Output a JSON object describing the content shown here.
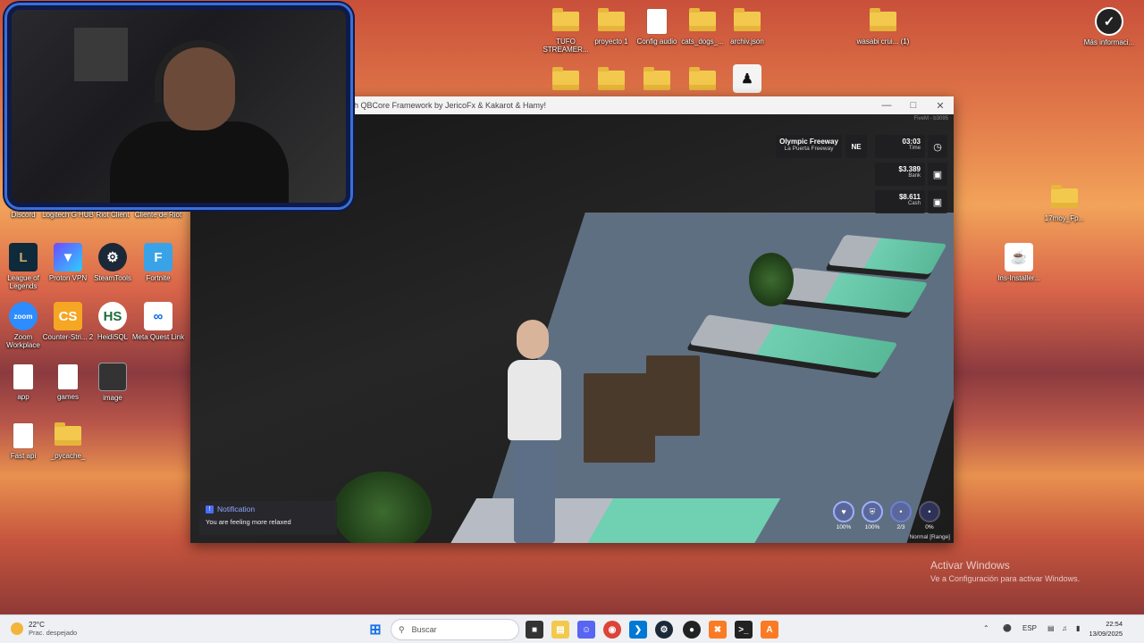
{
  "desktop": {
    "top_icons": [
      {
        "label": "TUFO STREAMER...",
        "type": "folder"
      },
      {
        "label": "proyecto 1",
        "type": "folder"
      },
      {
        "label": "Config audio",
        "type": "doc"
      },
      {
        "label": "cats_dogs_...",
        "type": "folder"
      },
      {
        "label": "archiv.json",
        "type": "folder"
      },
      {
        "label": "wasabi crui... (1)",
        "type": "folder"
      }
    ],
    "right_icons": [
      {
        "label": "Más informaci...",
        "type": "help"
      },
      {
        "label": "17moy_Fp...",
        "type": "folder"
      },
      {
        "label": "Ins-Installer...",
        "type": "java"
      }
    ],
    "left_icons": [
      {
        "label": "Discord"
      },
      {
        "label": "Logitech G HUB"
      },
      {
        "label": "Riot Client"
      },
      {
        "label": "Cliente de Riot"
      },
      {
        "label": "League of Legends"
      },
      {
        "label": "Proton VPN"
      },
      {
        "label": "SteamTools"
      },
      {
        "label": "Fortnite"
      },
      {
        "label": "Zoom Workplace"
      },
      {
        "label": "Counter-Stri... 2"
      },
      {
        "label": "HeidiSQL"
      },
      {
        "label": "Meta Quest Link"
      },
      {
        "label": "app"
      },
      {
        "label": "games"
      },
      {
        "label": "image"
      },
      {
        "label": "Fast api"
      },
      {
        "label": "_pycache_"
      }
    ]
  },
  "game_window": {
    "title": "with QBCore Framework by JericoFx & Kakarot & Hamy!",
    "watermark": "FiveM - b3095",
    "hud": {
      "street": "Olympic Freeway",
      "area": "La Puerta Freeway",
      "direction": "NE",
      "time_value": "03:03",
      "time_label": "Time",
      "bank_value": "$3.389",
      "bank_label": "Bank",
      "cash_value": "$8.611",
      "cash_label": "Cash",
      "clock_icon": "clock-icon",
      "money_icon": "cash-icon",
      "status": [
        {
          "name": "health",
          "value": "100%"
        },
        {
          "name": "armor",
          "value": "100%"
        },
        {
          "name": "stamina",
          "value": "2/3"
        },
        {
          "name": "stress",
          "value": "0%"
        }
      ],
      "voice": "Normal [Range]"
    },
    "notification": {
      "title": "Notification",
      "message": "You are feeling more relaxed"
    }
  },
  "activate_windows": {
    "title": "Activar Windows",
    "subtitle": "Ve a Configuración para activar Windows."
  },
  "taskbar": {
    "weather_temp": "22°C",
    "weather_desc": "Prac. despejado",
    "search_placeholder": "Buscar",
    "lang": "ESP",
    "time": "22:54",
    "date": "13/09/2025"
  }
}
